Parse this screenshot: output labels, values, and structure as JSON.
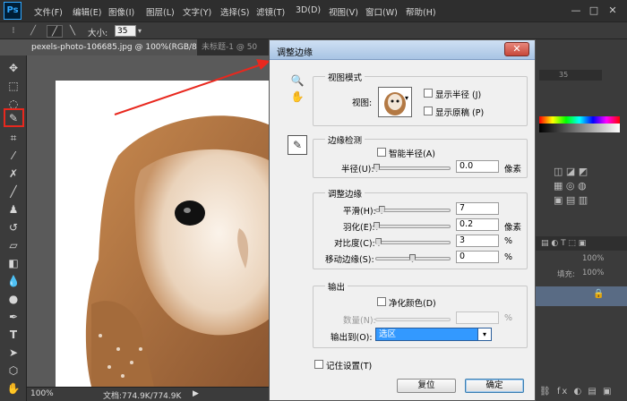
{
  "app": {
    "logo": "Ps"
  },
  "menu": [
    "文件(F)",
    "编辑(E)",
    "图像(I)",
    "图层(L)",
    "文字(Y)",
    "选择(S)",
    "滤镜(T)",
    "3D(D)",
    "视图(V)",
    "窗口(W)",
    "帮助(H)"
  ],
  "window_controls": [
    "—",
    "□",
    "✕"
  ],
  "options_bar": {
    "size_label": "大小:",
    "size_value": "35"
  },
  "tabs": [
    {
      "label": "pexels-photo-106685.jpg @ 100%(RGB/8) *",
      "close": "×"
    },
    {
      "label": "未标题-1 @ 50",
      "close": ""
    }
  ],
  "status_bar": {
    "zoom": "100%",
    "doc_info": "文档:774.9K/774.9K",
    "arrow": "▶"
  },
  "right_panel": {
    "value1": "35",
    "pct1": "100%",
    "fill_label": "填充:",
    "fill_value": "100%"
  },
  "dialog": {
    "title": "调整边缘",
    "close": "✕",
    "view_mode": {
      "title": "视图模式",
      "view_label": "视图:",
      "show_radius": "显示半径 (J)",
      "show_original": "显示原稿 (P)"
    },
    "edge_detection": {
      "title": "边缘检测",
      "smart_radius": "智能半径(A)",
      "radius_label": "半径(U):",
      "radius_value": "0.0",
      "radius_unit": "像素",
      "radius_level": 0
    },
    "adjust_edge": {
      "title": "调整边缘",
      "rows": [
        {
          "label": "平滑(H):",
          "value": "7",
          "unit": "",
          "level": 0.07
        },
        {
          "label": "羽化(E):",
          "value": "0.2",
          "unit": "像素",
          "level": 0.002
        },
        {
          "label": "对比度(C):",
          "value": "3",
          "unit": "%",
          "level": 0.03
        },
        {
          "label": "移动边缘(S):",
          "value": "0",
          "unit": "%",
          "level": 0.5
        }
      ]
    },
    "output": {
      "title": "输出",
      "decontaminate": "净化颜色(D)",
      "amount_label": "数量(N):",
      "amount_unit": "%",
      "output_to_label": "输出到(O):",
      "output_to_value": "选区"
    },
    "remember": "记住设置(T)",
    "reset_button": "复位",
    "ok_button": "确定"
  }
}
